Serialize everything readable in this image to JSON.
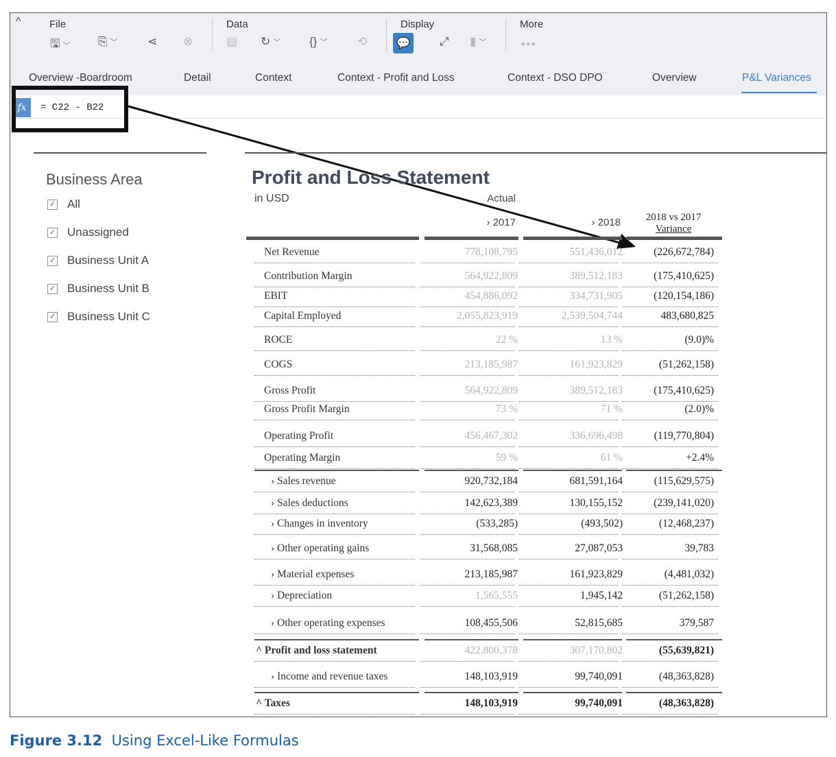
{
  "toolbar": {
    "groups": [
      "File",
      "Data",
      "Display",
      "More"
    ],
    "more_glyph": "∘∘∘"
  },
  "tabs": [
    "Overview -Boardroom",
    "Detail",
    "Context",
    "Context - Profit and Loss",
    "Context - DSO DPO",
    "Overview",
    "P&L Variances"
  ],
  "formula": {
    "fx": "fx",
    "text": "= C22 - B22"
  },
  "filter": {
    "title": "Business Area",
    "items": [
      "All",
      "Unassigned",
      "Business Unit A",
      "Business Unit B",
      "Business Unit C"
    ]
  },
  "table": {
    "title": "Profit and Loss Statement",
    "unit": "in USD",
    "actual_label": "Actual",
    "col_2017": "2017",
    "col_2018": "2018",
    "variance_header": [
      "2018 vs 2017",
      "Variance"
    ],
    "rows": [
      {
        "label": "Net Revenue",
        "v2017": "778,108,795",
        "v2018": "551,436,012",
        "var": "(226,672,784)"
      },
      {
        "label": "Contribution Margin",
        "v2017": "564,922,809",
        "v2018": "389,512,183",
        "var": "(175,410,625)"
      },
      {
        "label": "EBIT",
        "v2017": "454,886,092",
        "v2018": "334,731,905",
        "var": "(120,154,186)"
      },
      {
        "label": "Capital Employed",
        "v2017": "2,055,823,919",
        "v2018": "2,539,504,744",
        "var": "483,680,825"
      },
      {
        "label": "ROCE",
        "v2017": "22 %",
        "v2018": "13 %",
        "var": "(9.0)%"
      },
      {
        "label": "COGS",
        "v2017": "213,185,987",
        "v2018": "161,923,829",
        "var": "(51,262,158)"
      },
      {
        "label": "Gross Profit",
        "v2017": "564,922,809",
        "v2018": "389,512,183",
        "var": "(175,410,625)"
      },
      {
        "label": "Gross Profit Margin",
        "v2017": "73 %",
        "v2018": "71 %",
        "var": "(2.0)%"
      },
      {
        "label": "Operating Profit",
        "v2017": "456,467,302",
        "v2018": "336,696,498",
        "var": "(119,770,804)"
      },
      {
        "label": "Operating Margin",
        "v2017": "59 %",
        "v2018": "61 %",
        "var": "+2.4%"
      },
      {
        "label": "Sales revenue",
        "v2017": "920,732,184",
        "v2018": "681,591,164",
        "var": "(115,629,575)"
      },
      {
        "label": "Sales deductions",
        "v2017": "142,623,389",
        "v2018": "130,155,152",
        "var": "(239,141,020)"
      },
      {
        "label": "Changes in inventory",
        "v2017": "(533,285)",
        "v2018": "(493,502)",
        "var": "(12,468,237)"
      },
      {
        "label": "Other operating gains",
        "v2017": "31,568,085",
        "v2018": "27,087,053",
        "var": "39,783"
      },
      {
        "label": "Material expenses",
        "v2017": "213,185,987",
        "v2018": "161,923,829",
        "var": "(4,481,032)"
      },
      {
        "label": "Depreciation",
        "v2017": "1,565,555",
        "v2018": "1,945,142",
        "var": "(51,262,158)"
      },
      {
        "label": "Other operating expenses",
        "v2017": "108,455,506",
        "v2018": "52,815,685",
        "var": "379,587"
      },
      {
        "label": "Profit and loss statement",
        "v2017": "422,800,378",
        "v2018": "307,170,802",
        "var": "(55,639,821)"
      },
      {
        "label": "Income and revenue taxes",
        "v2017": "148,103,919",
        "v2018": "99,740,091",
        "var": "(48,363,828)"
      },
      {
        "label": "Taxes",
        "v2017": "148,103,919",
        "v2018": "99,740,091",
        "var": "(48,363,828)"
      }
    ]
  },
  "caption": {
    "label": "Figure 3.12",
    "text": "Using Excel-Like Formulas"
  },
  "colors": {
    "accent": "#3d7fc4",
    "toolbar_bg": "#eef0f3",
    "dim_value": "#b0b3b7",
    "caption": "#1f5fa5"
  }
}
